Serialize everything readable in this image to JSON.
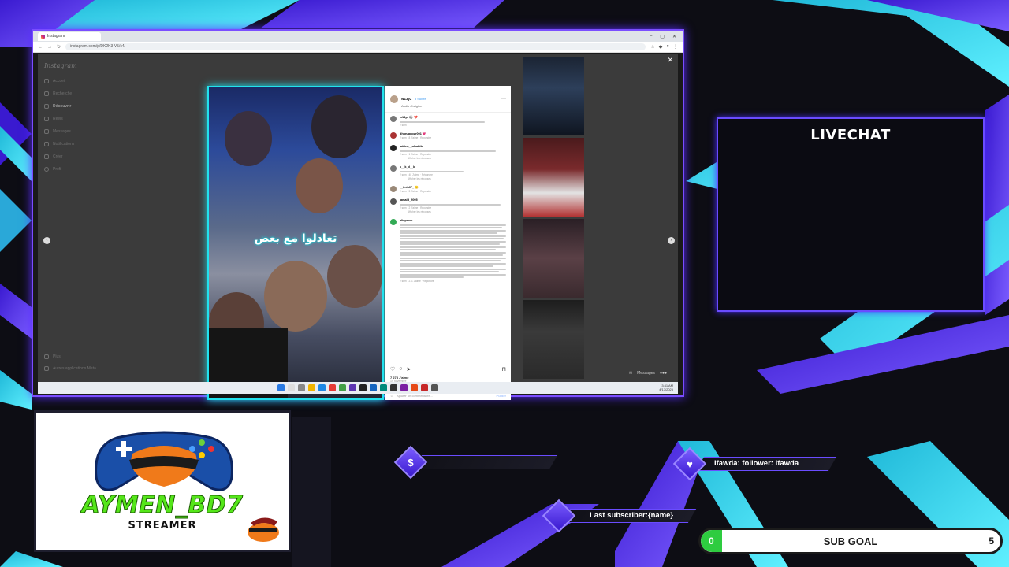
{
  "browser": {
    "tab_title": "Instagram",
    "url": "instagram.com/p/DK2K3-V5/c4/",
    "window_controls": [
      "–",
      "▢",
      "✕"
    ]
  },
  "instagram": {
    "logo": "Instagram",
    "nav": [
      {
        "label": "Accueil",
        "icon": "home-icon"
      },
      {
        "label": "Recherche",
        "icon": "search-icon"
      },
      {
        "label": "Découvrir",
        "icon": "compass-icon"
      },
      {
        "label": "Reels",
        "icon": "reels-icon"
      },
      {
        "label": "Messages",
        "icon": "message-icon"
      },
      {
        "label": "Notifications",
        "icon": "heart-icon"
      },
      {
        "label": "Créer",
        "icon": "plus-icon"
      },
      {
        "label": "Profil",
        "icon": "profile-icon"
      }
    ],
    "nav_bottom": [
      {
        "label": "Plus",
        "icon": "menu-icon"
      },
      {
        "label": "Autres applications Meta",
        "icon": "meta-icon"
      }
    ],
    "post": {
      "caption_overlay": "تعادلوا مع بعض",
      "author": "w13yz",
      "follow": "• Suivre",
      "audio": "Audio d'origine",
      "comments": [
        {
          "user": "w13yz",
          "text": "⚽ 💔",
          "meta": "2 sem"
        },
        {
          "user": "dhurugugur001",
          "text": "💗",
          "meta": "2 sem · 8 J'aime · Répondre"
        },
        {
          "user": "adrien__alhabib",
          "text": "",
          "meta": "2 sem · 1 J'aime · Répondre"
        },
        {
          "user": "k__k_d__k",
          "text": "",
          "meta": "2 sem · 40 J'aime · Répondre"
        },
        {
          "user": "__imik07_",
          "text": "🙂",
          "meta": "2 sem · 3 J'aime · Répondre"
        },
        {
          "user": "jamald_2005",
          "text": "",
          "meta": "2 sem · 2 J'aime · Répondre"
        },
        {
          "user": "alinpeuw",
          "text": "",
          "meta": "2 sem · 271 J'aime · Répondre"
        }
      ],
      "see_replies": "Afficher les réponses",
      "likes": "7 278 J'aime",
      "date": "19 novembre",
      "comment_placeholder": "Ajouter un commentaire...",
      "publish": "Publier"
    },
    "messages_label": "Messages"
  },
  "taskbar": {
    "time": "3:41 AM",
    "date": "4/17/2025"
  },
  "overlay": {
    "livechat_title": "LIVECHAT",
    "brand_name": "AYMEN_BD7",
    "brand_sub": "STREAMER",
    "donation_icon": "$",
    "follower_label": "Ifawda: follower: Ifawda",
    "subscriber_label": "Last subscriber:{name}",
    "subgoal": {
      "title": "SUB GOAL",
      "current": "0",
      "max": "5",
      "progress": 0.07
    }
  },
  "colors": {
    "accent_purple": "#6a4cff",
    "accent_cyan": "#22e2ee",
    "brand_green": "#55e61a",
    "goal_green": "#2ecc40"
  }
}
